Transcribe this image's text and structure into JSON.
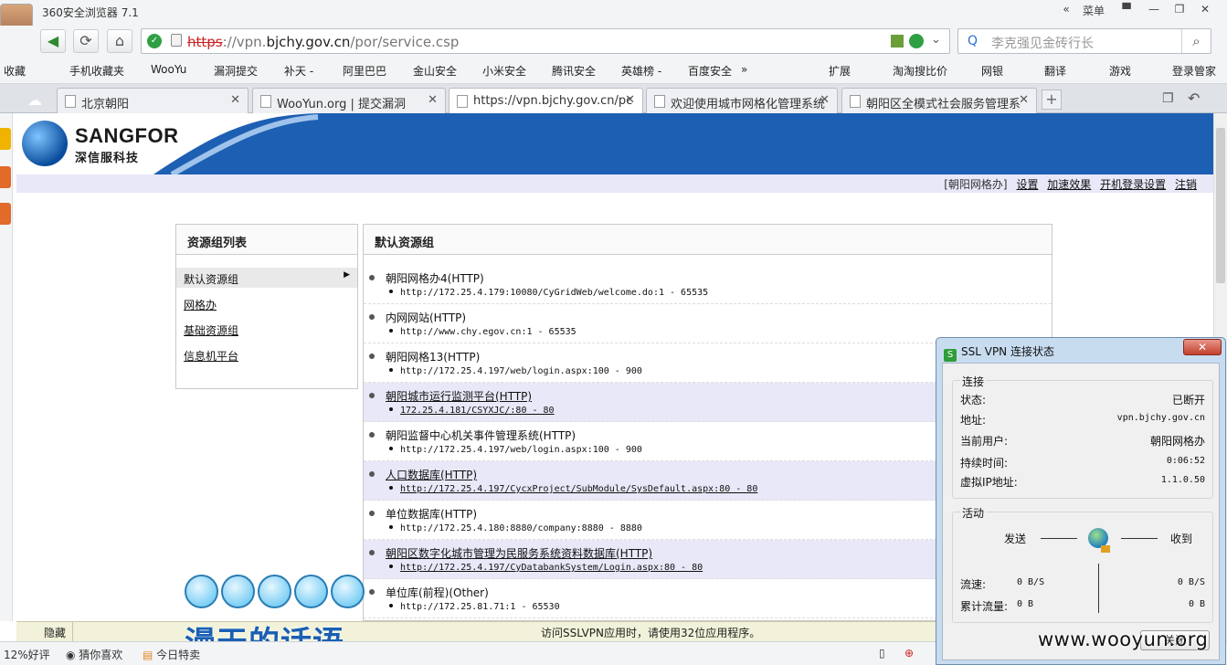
{
  "browser": {
    "app_title": "360安全浏览器 7.1",
    "menu_label": "菜单",
    "collapse_label": "«",
    "url_scheme": "https",
    "url_host_prefix": "://vpn.",
    "url_host": "bjchy.gov.cn",
    "url_path": "/por/service.csp",
    "search_placeholder": "李克强见金砖行长"
  },
  "favorites": [
    "收藏",
    "手机收藏夹",
    "WooYu",
    "漏洞提交",
    "补天 -",
    "阿里巴巴",
    "金山安全",
    "小米安全",
    "腾讯安全",
    "英雄榜 -",
    "百度安全",
    "»",
    "扩展",
    "淘淘搜比价",
    "网银",
    "翻译",
    "游戏",
    "登录管家"
  ],
  "tabs": [
    {
      "label": "北京朝阳"
    },
    {
      "label": "WooYun.org | 提交漏洞"
    },
    {
      "label": "https://vpn.bjchy.gov.cn/pc"
    },
    {
      "label": "欢迎使用城市网格化管理系统"
    },
    {
      "label": "朝阳区全模式社会服务管理系"
    }
  ],
  "header": {
    "logo_text": "SANGFOR",
    "logo_sub": "深信服科技",
    "user_tag": "[朝阳网格办]",
    "links": [
      "设置",
      "加速效果",
      "开机登录设置",
      "注销"
    ]
  },
  "left_panel": {
    "title": "资源组列表",
    "groups": [
      "默认资源组",
      "网格办",
      "基础资源组",
      "信息机平台"
    ],
    "selected_arrow": "▶"
  },
  "main_panel": {
    "title": "默认资源组",
    "resources": [
      {
        "name": "朝阳网格办4(HTTP)",
        "addr": "http://172.25.4.179:10080/CyGridWeb/welcome.do:1 - 65535",
        "hl": false
      },
      {
        "name": "内网网站(HTTP)",
        "addr": "http://www.chy.egov.cn:1 - 65535",
        "hl": false
      },
      {
        "name": "朝阳网格13(HTTP)",
        "addr": "http://172.25.4.197/web/login.aspx:100 - 900",
        "hl": false
      },
      {
        "name": "朝阳城市运行监测平台(HTTP)",
        "addr": "172.25.4.181/CSYXJC/:80 - 80",
        "hl": true
      },
      {
        "name": "朝阳监督中心机关事件管理系统(HTTP)",
        "addr": "http://172.25.4.197/web/login.aspx:100 - 900",
        "hl": false
      },
      {
        "name": "人口数据库(HTTP)",
        "addr": "http://172.25.4.197/CycxProject/SubModule/SysDefault.aspx:80 - 80",
        "hl": true
      },
      {
        "name": "单位数据库(HTTP)",
        "addr": "http://172.25.4.180:8880/company:8880 - 8880",
        "hl": false
      },
      {
        "name": "朝阳区数字化城市管理为民服务系统资料数据库(HTTP)",
        "addr": "http://172.25.4.197/CyDatabankSystem/Login.aspx:80 - 80",
        "hl": true
      },
      {
        "name": "单位库(前程)(Other)",
        "addr": "http://172.25.81.71:1 - 65530",
        "hl": false
      }
    ]
  },
  "bottom_bar": {
    "hide_label": "隐藏",
    "notice": "访问SSLVPN应用时，请使用32位应用程序。"
  },
  "status_bar": {
    "rating": "12%好评",
    "guess": "猜你喜欢",
    "today": "今日特卖"
  },
  "watermarks": {
    "cn": "漫天的话语",
    "en": "www.wooyun.org"
  },
  "vpn_dialog": {
    "title": "SSL VPN 连接状态",
    "close_x": "✕",
    "section_connect": "连接",
    "status_label": "状态:",
    "status_value": "已断开",
    "addr_label": "地址:",
    "addr_value": "vpn.bjchy.gov.cn",
    "user_label": "当前用户:",
    "user_value": "朝阳网格办",
    "duration_label": "持续时间:",
    "duration_value": "0:06:52",
    "vip_label": "虚拟IP地址:",
    "vip_value": "1.1.0.50",
    "section_activity": "活动",
    "send_label": "发送",
    "recv_label": "收到",
    "rate_label": "流速:",
    "rate_send": "0 B/S",
    "rate_recv": "0 B/S",
    "total_label": "累计流量:",
    "total_send": "0 B",
    "total_recv": "0 B",
    "close_button": "关闭"
  }
}
